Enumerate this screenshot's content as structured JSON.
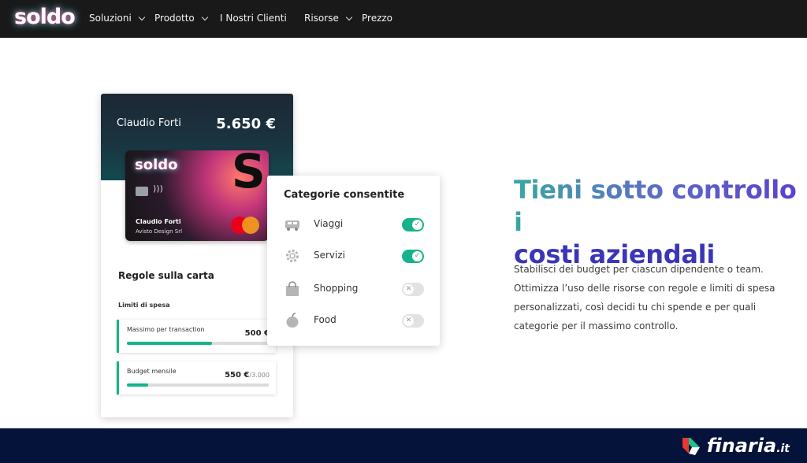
{
  "nav": {
    "logo": "soldo",
    "items": [
      {
        "label": "Soluzioni",
        "has_dropdown": true
      },
      {
        "label": "Prodotto",
        "has_dropdown": true
      },
      {
        "label": "I Nostri Clienti",
        "has_dropdown": false
      },
      {
        "label": "Risorse",
        "has_dropdown": true
      },
      {
        "label": "Prezzo",
        "has_dropdown": false
      }
    ]
  },
  "panel": {
    "holder_name": "Claudio Forti",
    "balance": "5.650 €",
    "card": {
      "logo": "soldo",
      "name": "Claudio Forti",
      "company": "Avisto Design Srl",
      "nfc_icon": "contactless-icon",
      "brand": "mastercard"
    },
    "rules_title": "Regole sulla carta",
    "limits_title": "Limiti di spesa",
    "limits": [
      {
        "label": "Massimo per transaction",
        "value": "500 €",
        "max": "",
        "progress": 0.6
      },
      {
        "label": "Budget mensile",
        "value": "550 €",
        "max": "/3.000",
        "progress": 0.15
      }
    ]
  },
  "categories": {
    "title": "Categorie consentite",
    "items": [
      {
        "label": "Viaggi",
        "icon": "car-icon",
        "enabled": true
      },
      {
        "label": "Servizi",
        "icon": "gear-icon",
        "enabled": true
      },
      {
        "label": "Shopping",
        "icon": "shopping-bag-icon",
        "enabled": false
      },
      {
        "label": "Food",
        "icon": "apple-icon",
        "enabled": false
      }
    ]
  },
  "hero": {
    "headline_line1": "Tieni sotto controllo i",
    "headline_line2": "costi aziendali",
    "body": "Stabilisci dei budget per ciascun dipendente o team. Ottimizza l’uso delle risorse con regole e limiti di spesa personalizzati, così decidi tu chi spende e per quali categorie per il massimo controllo."
  },
  "footer": {
    "brand": "finaria",
    "brand_suffix": ".it"
  },
  "colors": {
    "accent_green": "#16b38a",
    "headline_purple": "#3b35b8",
    "nav_bg": "#191919",
    "footer_bg": "#05123a"
  }
}
